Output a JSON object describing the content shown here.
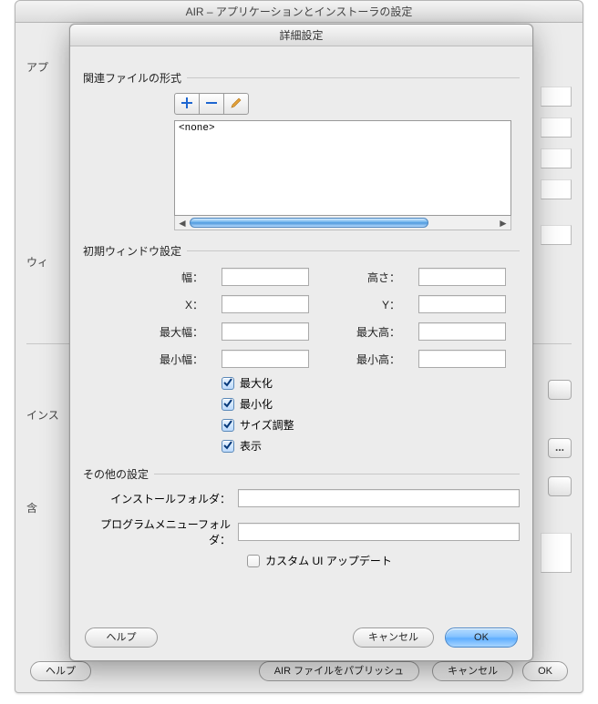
{
  "parent_window": {
    "title": "AIR – アプリケーションとインストーラの設定",
    "sidebar_labels": {
      "app": "アプ",
      "win": "ウィ",
      "inst": "インス",
      "inc": "含"
    },
    "dots": "...",
    "buttons": {
      "help": "ヘルプ",
      "publish": "AIR ファイルをパブリッシュ",
      "cancel": "キャンセル",
      "ok": "OK"
    }
  },
  "modal": {
    "title": "詳細設定",
    "sections": {
      "file_types": {
        "legend": "関連ファイルの形式",
        "list_placeholder": "<none>",
        "toolbar": {
          "add": "add",
          "remove": "remove",
          "edit": "edit"
        }
      },
      "initial_window": {
        "legend": "初期ウィンドウ設定",
        "fields": {
          "width": {
            "label": "幅：",
            "value": ""
          },
          "height": {
            "label": "高さ：",
            "value": ""
          },
          "x": {
            "label": "X：",
            "value": ""
          },
          "y": {
            "label": "Y：",
            "value": ""
          },
          "max_width": {
            "label": "最大幅：",
            "value": ""
          },
          "max_height": {
            "label": "最大高：",
            "value": ""
          },
          "min_width": {
            "label": "最小幅：",
            "value": ""
          },
          "min_height": {
            "label": "最小高：",
            "value": ""
          }
        },
        "checkboxes": {
          "maximizable": {
            "label": "最大化",
            "checked": true
          },
          "minimizable": {
            "label": "最小化",
            "checked": true
          },
          "resizable": {
            "label": "サイズ調整",
            "checked": true
          },
          "visible": {
            "label": "表示",
            "checked": true
          }
        }
      },
      "other": {
        "legend": "その他の設定",
        "install_folder": {
          "label": "インストールフォルダ：",
          "value": ""
        },
        "program_menu": {
          "label": "プログラムメニューフォルダ：",
          "value": ""
        },
        "custom_update": {
          "label": "カスタム UI アップデート",
          "checked": false
        }
      }
    },
    "buttons": {
      "help": "ヘルプ",
      "cancel": "キャンセル",
      "ok": "OK"
    }
  }
}
